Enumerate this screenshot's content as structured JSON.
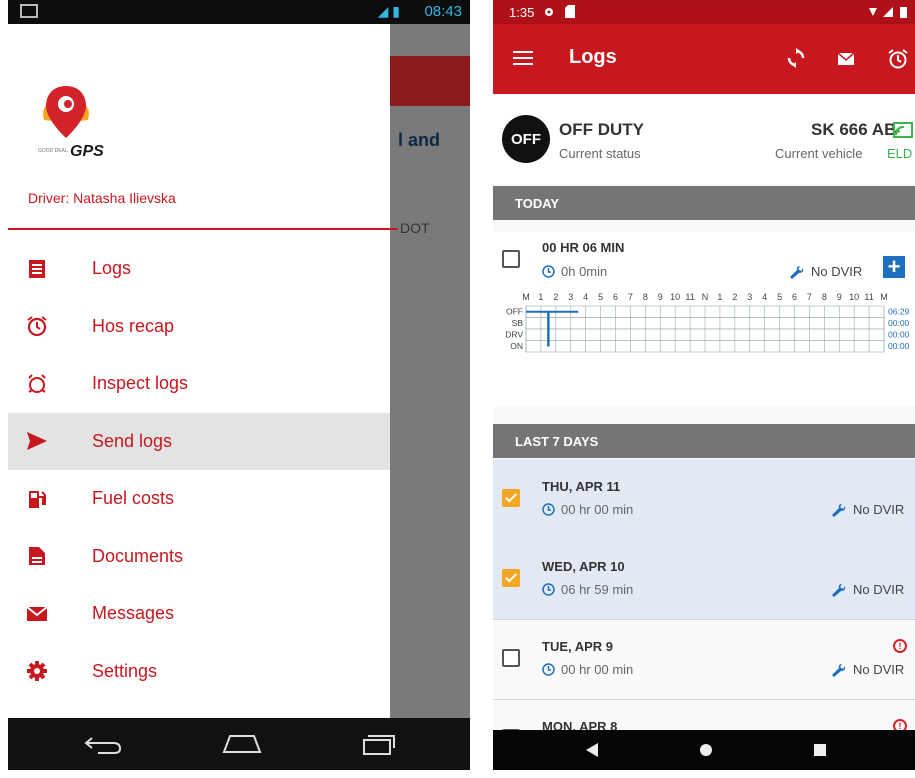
{
  "left": {
    "status_time": "08:43",
    "driver_label": "Driver: Natasha Ilievska",
    "logo_text": "GPS",
    "logo_small": "GOOD DEAL",
    "bg_fragment_1": "l and",
    "bg_fragment_2": "DOT",
    "menu": [
      {
        "label": "Logs",
        "icon": "logs-list-icon"
      },
      {
        "label": "Hos recap",
        "icon": "alarm-clock-icon"
      },
      {
        "label": "Inspect logs",
        "icon": "inspect-clock-icon"
      },
      {
        "label": "Send logs",
        "icon": "send-arrow-icon",
        "selected": true
      },
      {
        "label": "Fuel costs",
        "icon": "fuel-pump-icon"
      },
      {
        "label": "Documents",
        "icon": "document-icon"
      },
      {
        "label": "Messages",
        "icon": "envelope-icon"
      },
      {
        "label": "Settings",
        "icon": "gear-icon"
      }
    ]
  },
  "right": {
    "status_time": "1:35",
    "appbar_title": "Logs",
    "current_status": {
      "code": "OFF",
      "title": "OFF DUTY",
      "subtitle": "Current status"
    },
    "vehicle": {
      "title": "SK 666 AB",
      "subtitle": "Current vehicle",
      "eld": "ELD"
    },
    "today_header": "TODAY",
    "today": {
      "duration": "00 HR 06 MIN",
      "clock": "0h 0min",
      "dvir": "No DVIR"
    },
    "graph": {
      "hours": [
        "M",
        "1",
        "2",
        "3",
        "4",
        "5",
        "6",
        "7",
        "8",
        "9",
        "10",
        "11",
        "N",
        "1",
        "2",
        "3",
        "4",
        "5",
        "6",
        "7",
        "8",
        "9",
        "10",
        "11",
        "M"
      ],
      "rows": [
        "OFF",
        "SB",
        "DRV",
        "ON"
      ],
      "totals": [
        "06:29",
        "00:00",
        "00:00",
        "00:00"
      ],
      "segments": [
        {
          "row": "OFF",
          "from": 0,
          "to": 3.5
        },
        {
          "row": "OFF",
          "to_row": "DRV",
          "at": 1.5
        }
      ]
    },
    "last7_header": "LAST 7 DAYS",
    "days": [
      {
        "date": "THU, APR 11",
        "time": "00 hr 00 min",
        "dvir": "No DVIR",
        "checked": true,
        "alert": false
      },
      {
        "date": "WED, APR 10",
        "time": "06 hr 59 min",
        "dvir": "No DVIR",
        "checked": true,
        "alert": false
      },
      {
        "date": "TUE, APR 9",
        "time": "00 hr 00 min",
        "dvir": "No DVIR",
        "checked": false,
        "alert": true
      },
      {
        "date": "MON, APR 8",
        "time": "",
        "dvir": "",
        "checked": false,
        "alert": true
      }
    ],
    "colors": {
      "primary": "#c8181f",
      "status_bar": "#ae1118",
      "check": "#f5a623",
      "eld": "#39b54a",
      "plus": "#1f6fbf"
    }
  }
}
